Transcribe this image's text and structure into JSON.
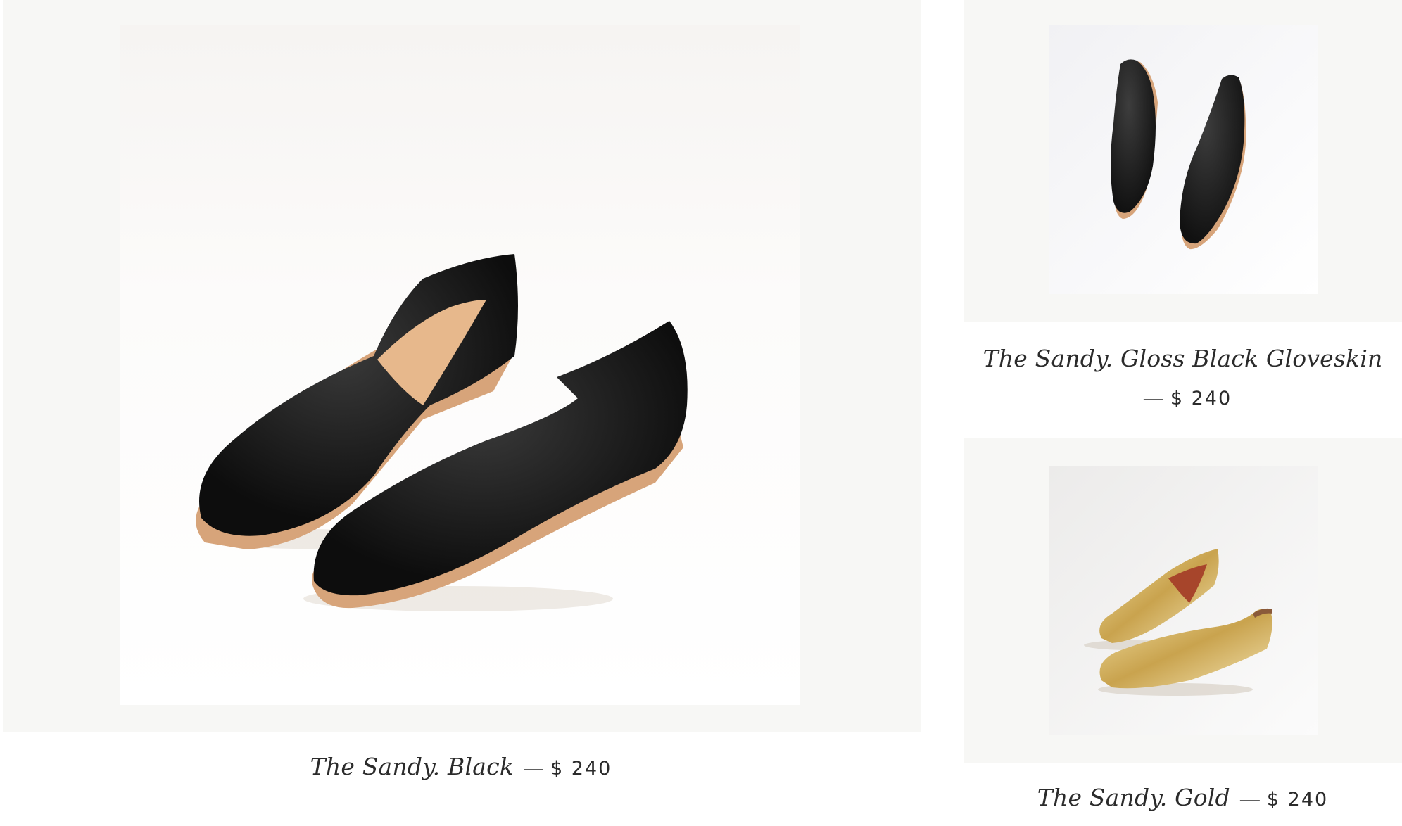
{
  "products": [
    {
      "title": "The Sandy. Black",
      "dash": "—",
      "price": "$ 240",
      "image_alt": "Black leather flat shoes"
    },
    {
      "title": "The Sandy. Gloss Black Gloveskin",
      "dash": "—",
      "price": "$ 240",
      "image_alt": "Gloss black gloveskin flat shoes"
    },
    {
      "title": "The Sandy. Gold",
      "dash": "—",
      "price": "$ 240",
      "image_alt": "Gold metallic flat shoes"
    }
  ],
  "colors": {
    "frame_bg": "#f7f7f5",
    "text": "#2b2b2b",
    "leather_black": "#151515",
    "sole_tan": "#d9a77a",
    "gold": "#d9bf74"
  }
}
